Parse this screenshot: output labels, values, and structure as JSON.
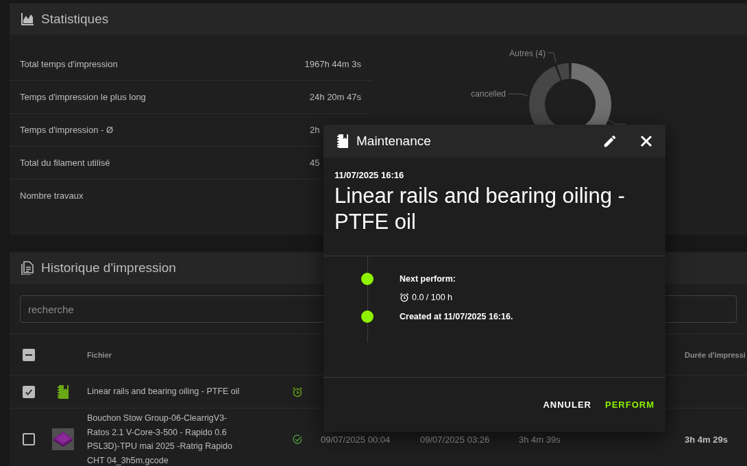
{
  "statistics": {
    "title": "Statistiques",
    "rows": [
      {
        "label": "Total temps d'impression",
        "value": "1967h 44m 3s"
      },
      {
        "label": "Temps d'impression le plus long",
        "value": "24h 20m 47s"
      },
      {
        "label": "Temps d'impression - Ø",
        "value": "2h"
      },
      {
        "label": "Total du filament utilisé",
        "value": "45"
      },
      {
        "label": "Nombre travaux"
      }
    ],
    "donut_labels": [
      "Autres (4)",
      "cancelled"
    ]
  },
  "history": {
    "title": "Historique d'impression",
    "search": {
      "placeholder": "recherche"
    },
    "select_all": {
      "indeterminate": true
    },
    "columns": {
      "file": "Fichier",
      "print_duration": "Durée d'impressi"
    },
    "rows": [
      {
        "checked": true,
        "kind": "maintenance",
        "file": "Linear rails and bearing oiling - PTFE oil"
      },
      {
        "checked": false,
        "kind": "job",
        "file": "Bouchon Stow Group-06-ClearrigV3-Ratos 2.1 V-Core-3-500 - Rapido 0.6 PSL3D)-TPU mai 2025 -Ratrig Rapido CHT 04_3h5m.gcode",
        "column_5": "09/07/2025 00:04",
        "column_6": "09/07/2025 03:26",
        "column_7": "3h 4m 39s",
        "print_duration": "3h 4m 29s"
      }
    ]
  },
  "dialog": {
    "title": "Maintenance",
    "date": "11/07/2025 16:16",
    "name": "Linear rails and bearing oiling - PTFE oil",
    "timeline": [
      {
        "title": "Next perform:",
        "detail": "0.0 / 100 h"
      },
      {
        "title": "Created at 11/07/2025 16:16."
      }
    ],
    "buttons": [
      {
        "label": "ANNULER",
        "kind": "cancel"
      },
      {
        "label": "PERFORM",
        "kind": "primary"
      }
    ]
  }
}
